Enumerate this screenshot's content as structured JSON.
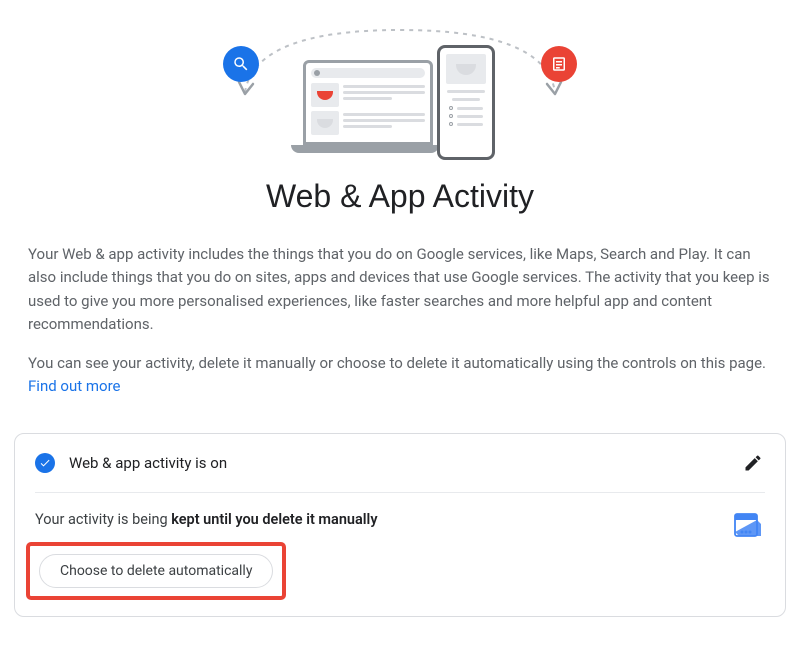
{
  "title": "Web & App Activity",
  "description": {
    "p1": "Your Web & app activity includes the things that you do on Google services, like Maps, Search and Play. It can also include things that you do on sites, apps and devices that use Google services. The activity that you keep is used to give you more personalised experiences, like faster searches and more helpful app and content recommendations.",
    "p2_pre": "You can see your activity, delete it manually or choose to delete it automatically using the controls on this page. ",
    "link_label": "Find out more"
  },
  "card": {
    "status_label": "Web & app activity is on",
    "retention_pre": "Your activity is being ",
    "retention_bold": "kept until you delete it manually",
    "button_label": "Choose to delete automatically"
  }
}
